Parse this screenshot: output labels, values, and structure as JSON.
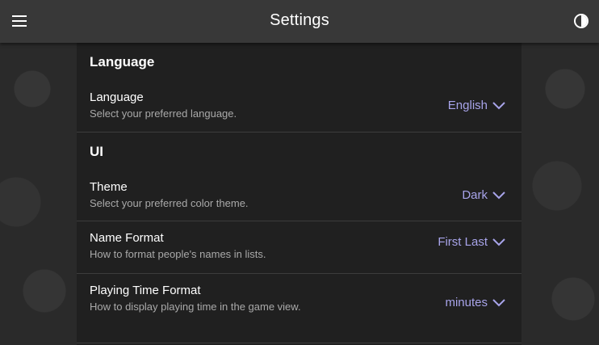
{
  "header": {
    "title": "Settings",
    "menu_icon": "hamburger-menu-icon",
    "theme_icon": "contrast-icon"
  },
  "sections": [
    {
      "title": "Language",
      "settings": [
        {
          "label": "Language",
          "description": "Select your preferred language.",
          "value": "English"
        }
      ]
    },
    {
      "title": "UI",
      "settings": [
        {
          "label": "Theme",
          "description": "Select your preferred color theme.",
          "value": "Dark"
        },
        {
          "label": "Name Format",
          "description": "How to format people's names in lists.",
          "value": "First Last"
        },
        {
          "label": "Playing Time Format",
          "description": "How to display playing time in the game view.",
          "value": "minutes"
        }
      ]
    }
  ],
  "colors": {
    "accent": "#a8a4ea",
    "appbar": "#383838",
    "panel": "#202020"
  }
}
